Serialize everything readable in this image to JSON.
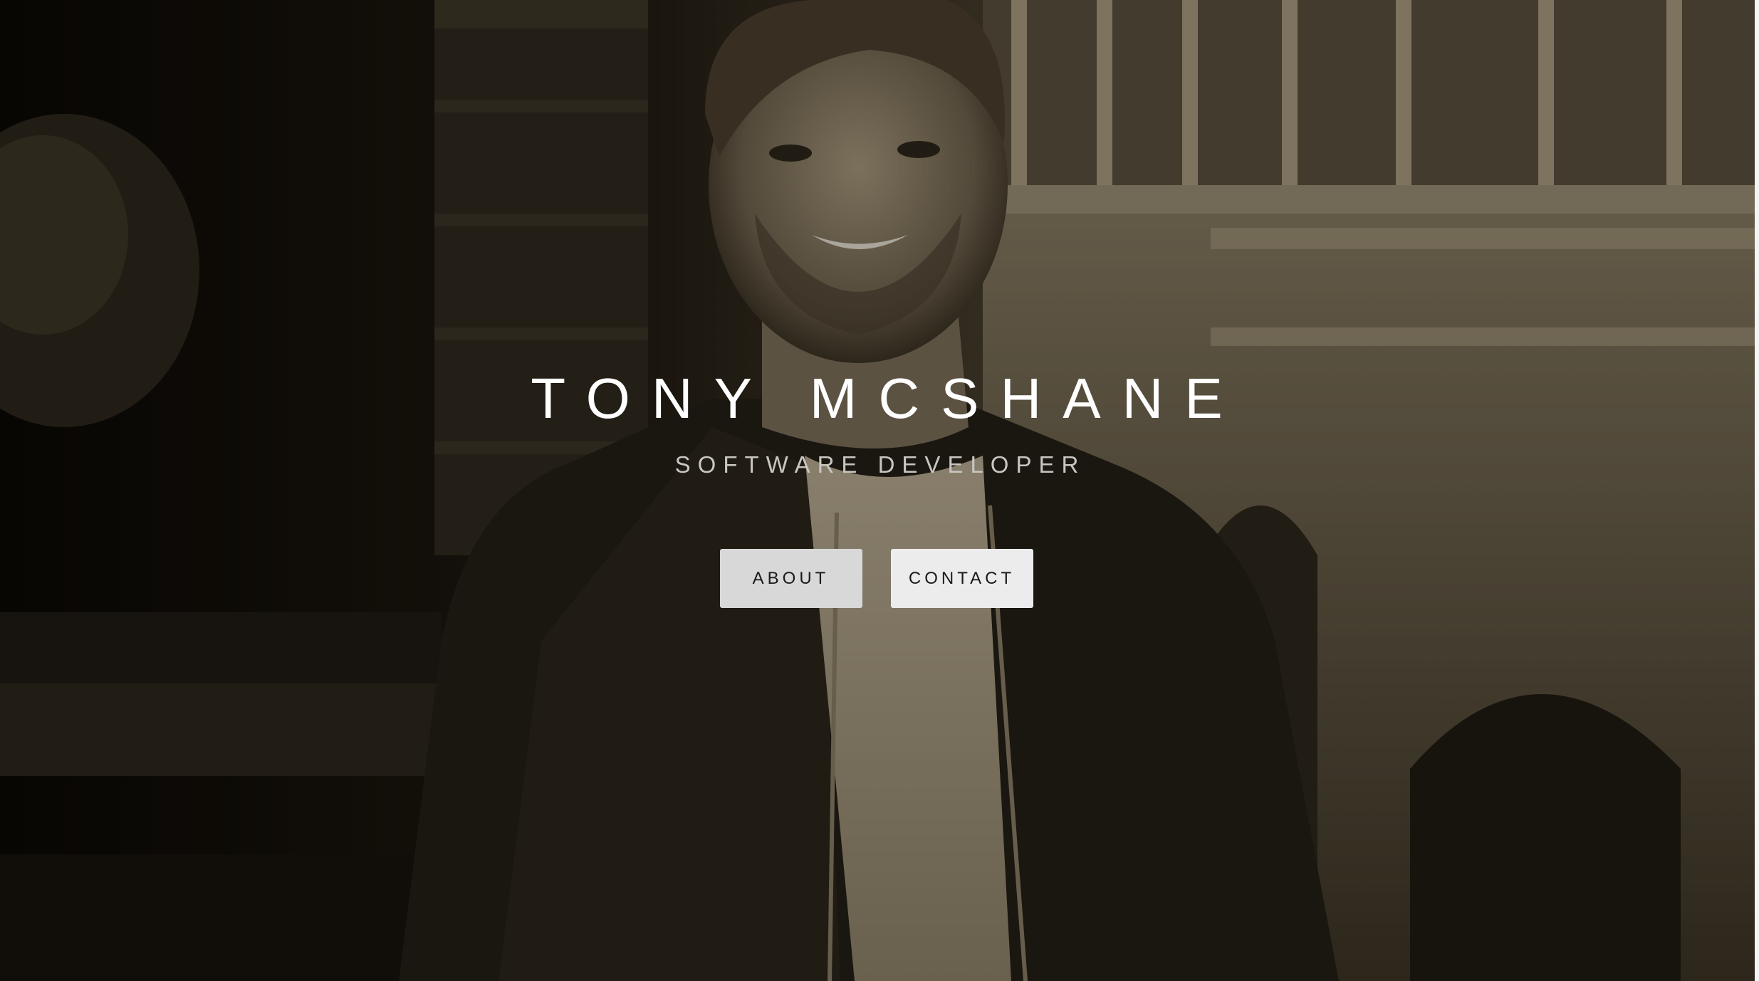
{
  "hero": {
    "name": "TONY MCSHANE",
    "role": "SOFTWARE DEVELOPER",
    "buttons": {
      "about": "ABOUT",
      "contact": "CONTACT"
    }
  },
  "colors": {
    "tint": "#2b2418",
    "title": "#ffffff",
    "subtitle": "#c9c6c2",
    "button_bg": "#d8d8d8",
    "button_text": "#1a1a1a"
  }
}
